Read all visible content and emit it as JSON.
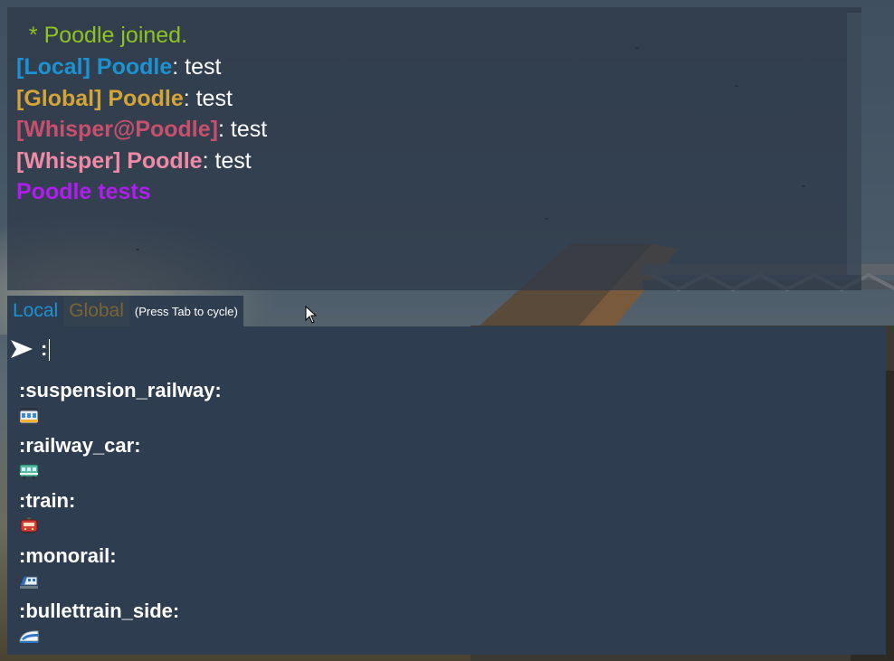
{
  "chat": {
    "messages": [
      {
        "parts": [
          {
            "text": "  * Poodle joined.",
            "color": "#8fc31f",
            "bold": false
          }
        ]
      },
      {
        "parts": [
          {
            "text": "[Local] Poodle",
            "color": "#1c92d2",
            "bold": true
          },
          {
            "text": ": test",
            "color": "#ffffff",
            "bold": false
          }
        ]
      },
      {
        "parts": [
          {
            "text": "[Global] Poodle",
            "color": "#d4a536",
            "bold": true
          },
          {
            "text": ": test",
            "color": "#ffffff",
            "bold": false
          }
        ]
      },
      {
        "parts": [
          {
            "text": "[Whisper@Poodle]",
            "color": "#c9506d",
            "bold": true
          },
          {
            "text": ": test",
            "color": "#ffffff",
            "bold": false
          }
        ]
      },
      {
        "parts": [
          {
            "text": "[Whisper] Poodle",
            "color": "#f08aa6",
            "bold": true
          },
          {
            "text": ": test",
            "color": "#ffffff",
            "bold": false
          }
        ]
      },
      {
        "parts": [
          {
            "text": "Poodle tests",
            "color": "#b11cf0",
            "bold": true
          }
        ]
      }
    ]
  },
  "tabs": {
    "local": "Local",
    "global": "Global",
    "hint": "(Press Tab to cycle)"
  },
  "input": {
    "value": ":",
    "send_icon": "send-arrow-icon"
  },
  "suggestions": [
    {
      "label": ":suspension_railway:",
      "icon": "suspension-railway-emoji"
    },
    {
      "label": ":railway_car:",
      "icon": "railway-car-emoji"
    },
    {
      "label": ":train:",
      "icon": "train-emoji"
    },
    {
      "label": ":monorail:",
      "icon": "monorail-emoji"
    },
    {
      "label": ":bullettrain_side:",
      "icon": "bullettrain-side-emoji"
    }
  ],
  "colors": {
    "local": "#1c92d2",
    "global": "#d4a536",
    "whisper_to": "#c9506d",
    "whisper_from": "#f08aa6",
    "emote": "#b11cf0",
    "system": "#8fc31f",
    "panel": "#2e3d50"
  }
}
